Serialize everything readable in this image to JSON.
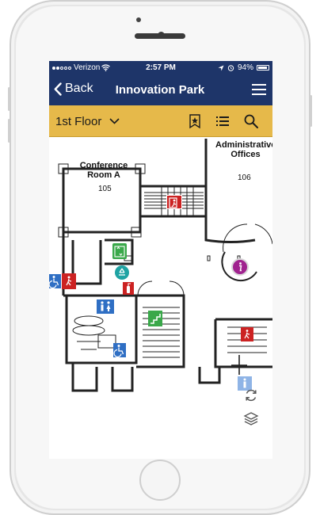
{
  "status": {
    "carrier": "Verizon",
    "time": "2:57 PM",
    "battery": "94%"
  },
  "nav": {
    "back_label": "Back",
    "title": "Innovation Park"
  },
  "floor": {
    "selected": "1st Floor"
  },
  "map": {
    "rooms": [
      {
        "name": "Conference Room A",
        "number": "105"
      },
      {
        "name": "Administrative Offices",
        "number": "106"
      }
    ]
  },
  "colors": {
    "navbar": "#1e3569",
    "floorbar": "#e6b94a",
    "exit": "#cc2222",
    "elevator": "#3aa84a",
    "restroom": "#2f6fc4",
    "info": "#a0238f"
  },
  "icons": [
    "back-chevron-icon",
    "hamburger-menu-icon",
    "chevron-down-icon",
    "bookmark-star-icon",
    "list-icon",
    "search-icon",
    "exit-icon",
    "accessible-icon",
    "elevator-icon",
    "recycle-icon",
    "fire-extinguisher-icon",
    "restroom-icon",
    "info-icon",
    "stairs-icon",
    "refresh-icon",
    "layers-icon"
  ]
}
